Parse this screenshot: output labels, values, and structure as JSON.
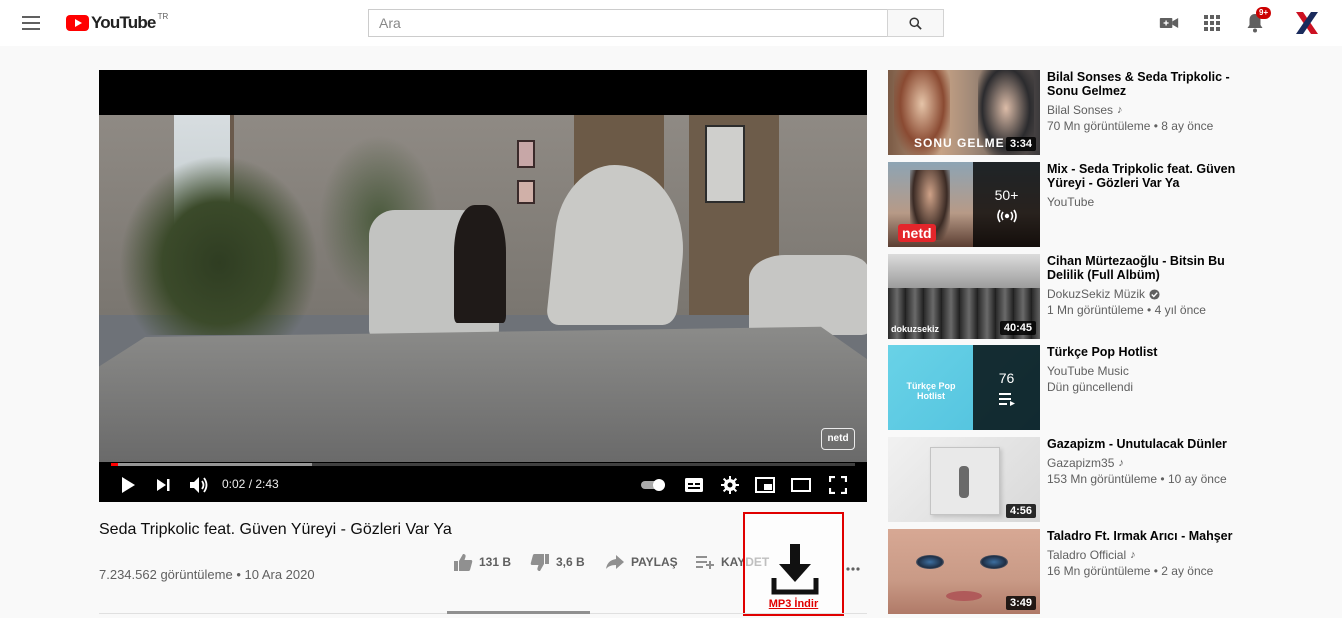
{
  "header": {
    "logo_text": "YouTube",
    "country_code": "TR",
    "search_placeholder": "Ara",
    "notification_count": "9+"
  },
  "player": {
    "time": "0:02 / 2:43",
    "progress_played": 0.01,
    "progress_loaded": 0.27,
    "watermark": "netd"
  },
  "video": {
    "title": "Seda Tripkolic feat. Güven Yüreyi - Gözleri Var Ya",
    "views_date": "7.234.562 görüntüleme • 10 Ara 2020",
    "likes": "131 B",
    "dislikes": "3,6 B",
    "share_label": "PAYLAŞ",
    "save_label": "KAYDET"
  },
  "download": {
    "label": "MP3 İndir"
  },
  "recommendations": [
    {
      "title": "Bilal Sonses & Seda Tripkolic - Sonu Gelmez",
      "channel": "Bilal Sonses",
      "channel_badge": "music-note-icon",
      "stats": "70 Mn görüntüleme • 8 ay önce",
      "duration": "3:34",
      "thumb_text": "SONU GELME"
    },
    {
      "title": "Mix - Seda Tripkolic feat. Güven Yüreyi - Gözleri Var Ya",
      "channel": "YouTube",
      "stats": "",
      "playlist_count": "50+",
      "playlist_icon": "radio-icon",
      "thumb_text": "netd"
    },
    {
      "title": "Cihan Mürtezaoğlu - Bitsin Bu Delilik (Full Albüm)",
      "channel": "DokuzSekiz Müzik",
      "channel_badge": "verified-icon",
      "stats": "1 Mn görüntüleme • 4 yıl önce",
      "duration": "40:45",
      "thumb_text": "dokuzsekiz"
    },
    {
      "title": "Türkçe Pop Hotlist",
      "channel": "YouTube Music",
      "stats": "Dün güncellendi",
      "playlist_count": "76",
      "playlist_icon": "playlist-icon",
      "thumb_text": "Türkçe Pop Hotlist"
    },
    {
      "title": "Gazapizm - Unutulacak Dünler",
      "channel": "Gazapizm35",
      "channel_badge": "music-note-icon",
      "stats": "153 Mn görüntüleme • 10 ay önce",
      "duration": "4:56"
    },
    {
      "title": "Taladro Ft. Irmak Arıcı - Mahşer",
      "channel": "Taladro Official",
      "channel_badge": "music-note-icon",
      "stats": "16 Mn görüntüleme • 2 ay önce",
      "duration": "3:49"
    }
  ],
  "colors": {
    "brand_red": "#ff0000",
    "download_red": "#e00000",
    "text_secondary": "#606060"
  }
}
